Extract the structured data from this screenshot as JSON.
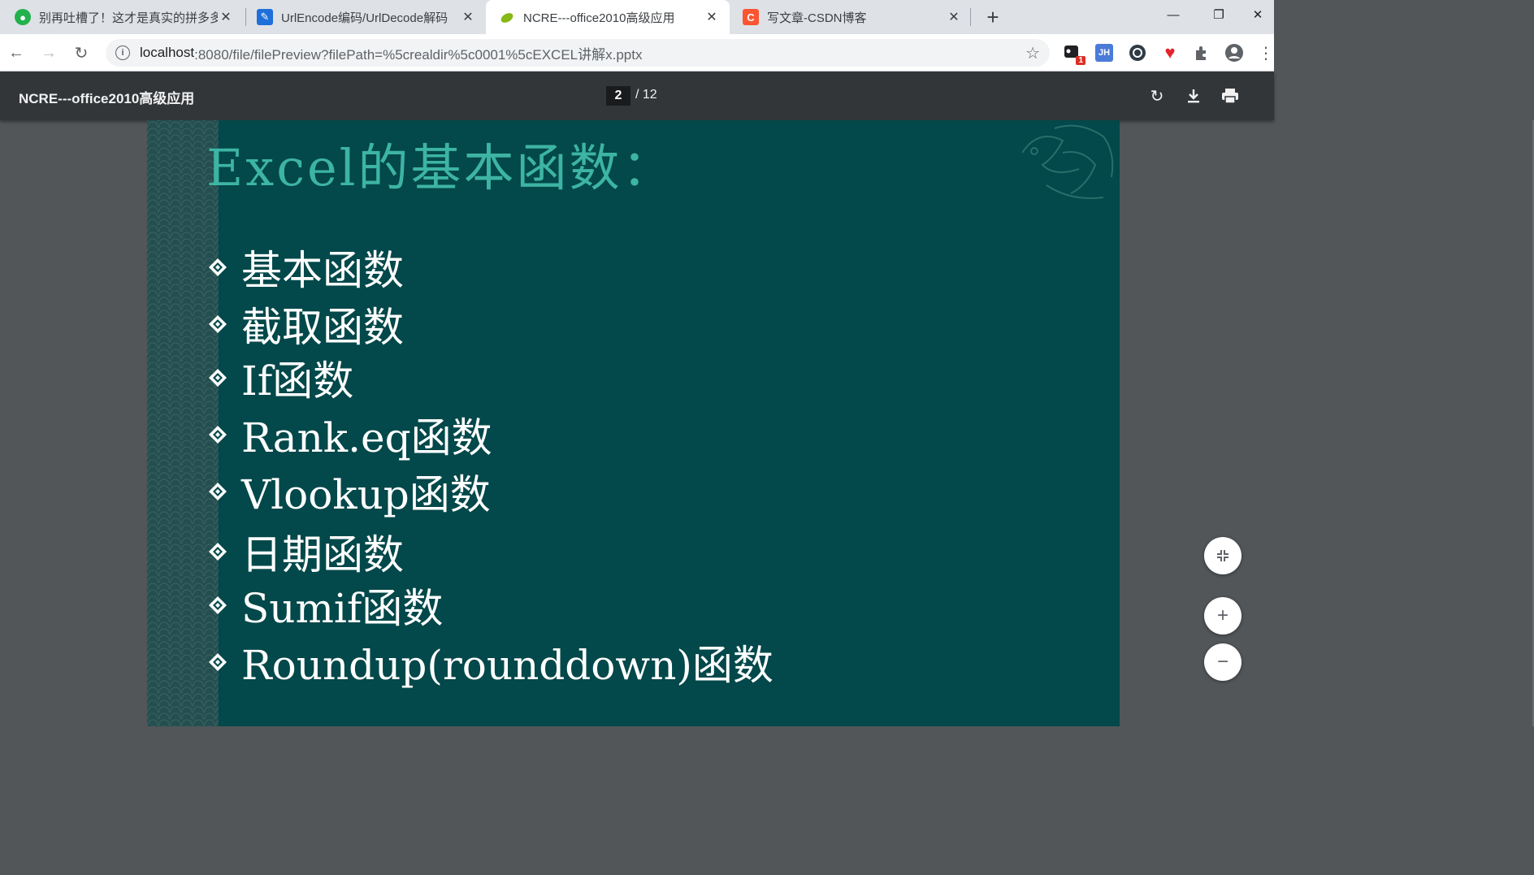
{
  "browser": {
    "tabs": [
      {
        "title": "别再吐槽了！这才是真实的拼多多",
        "icon": "wechat-icon",
        "color": "#22b14c"
      },
      {
        "title": "UrlEncode编码/UrlDecode解码",
        "icon": "pencil-icon",
        "color": "#1e6fd9"
      },
      {
        "title": "NCRE---office2010高级应用",
        "icon": "leaf-icon",
        "color": "#86b817"
      },
      {
        "title": "写文章-CSDN博客",
        "icon": "csdn-icon",
        "color": "#fc5531"
      }
    ],
    "active_tab": 2,
    "url_host": "localhost",
    "url_rest": ":8080/file/filePreview?filePath=%5crealdir%5c0001%5cEXCEL讲解x.pptx",
    "extension_badge": "1",
    "extension_jh_label": "JH"
  },
  "viewer": {
    "doc_title": "NCRE---office2010高级应用",
    "current_page": "2",
    "total_pages": "/ 12"
  },
  "slide": {
    "title": "Excel的基本函数：",
    "bullets": [
      "基本函数",
      "截取函数",
      "If函数",
      "Rank.eq函数",
      "Vlookup函数",
      " 日期函数",
      "Sumif函数",
      "Roundup(rounddown)函数"
    ]
  }
}
